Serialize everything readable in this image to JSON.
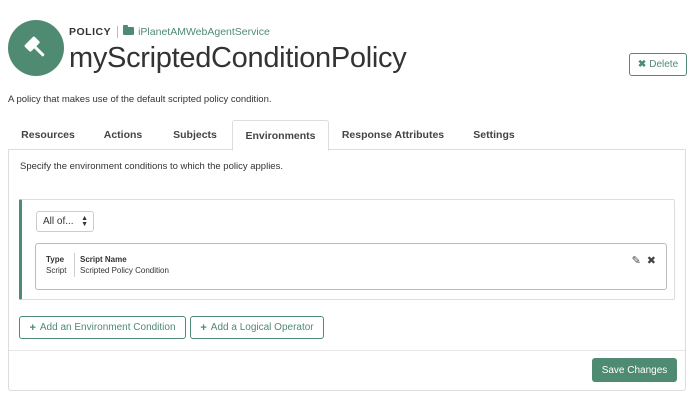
{
  "header": {
    "avatar_icon": "gavel-icon",
    "type_label": "POLICY",
    "application_icon": "folder-icon",
    "application": "iPlanetAMWebAgentService",
    "title": "myScriptedConditionPolicy",
    "delete_label": "Delete"
  },
  "description": "A policy that makes use of the default scripted policy condition.",
  "tabs": [
    {
      "label": "Resources",
      "active": false
    },
    {
      "label": "Actions",
      "active": false
    },
    {
      "label": "Subjects",
      "active": false
    },
    {
      "label": "Environments",
      "active": true
    },
    {
      "label": "Response Attributes",
      "active": false
    },
    {
      "label": "Settings",
      "active": false
    }
  ],
  "environments": {
    "intro": "Specify the environment conditions to which the policy applies.",
    "logic_operator": "All of...",
    "condition": {
      "type_header": "Type",
      "type_value": "Script",
      "name_header": "Script Name",
      "name_value": "Scripted Policy Condition",
      "edit_icon": "pencil-icon",
      "remove_icon": "close-icon"
    },
    "add_condition_label": "Add an Environment Condition",
    "add_operator_label": "Add a Logical Operator"
  },
  "footer": {
    "save_label": "Save Changes"
  },
  "colors": {
    "accent": "#4f8a72",
    "border": "#dddddd",
    "text": "#333333"
  }
}
